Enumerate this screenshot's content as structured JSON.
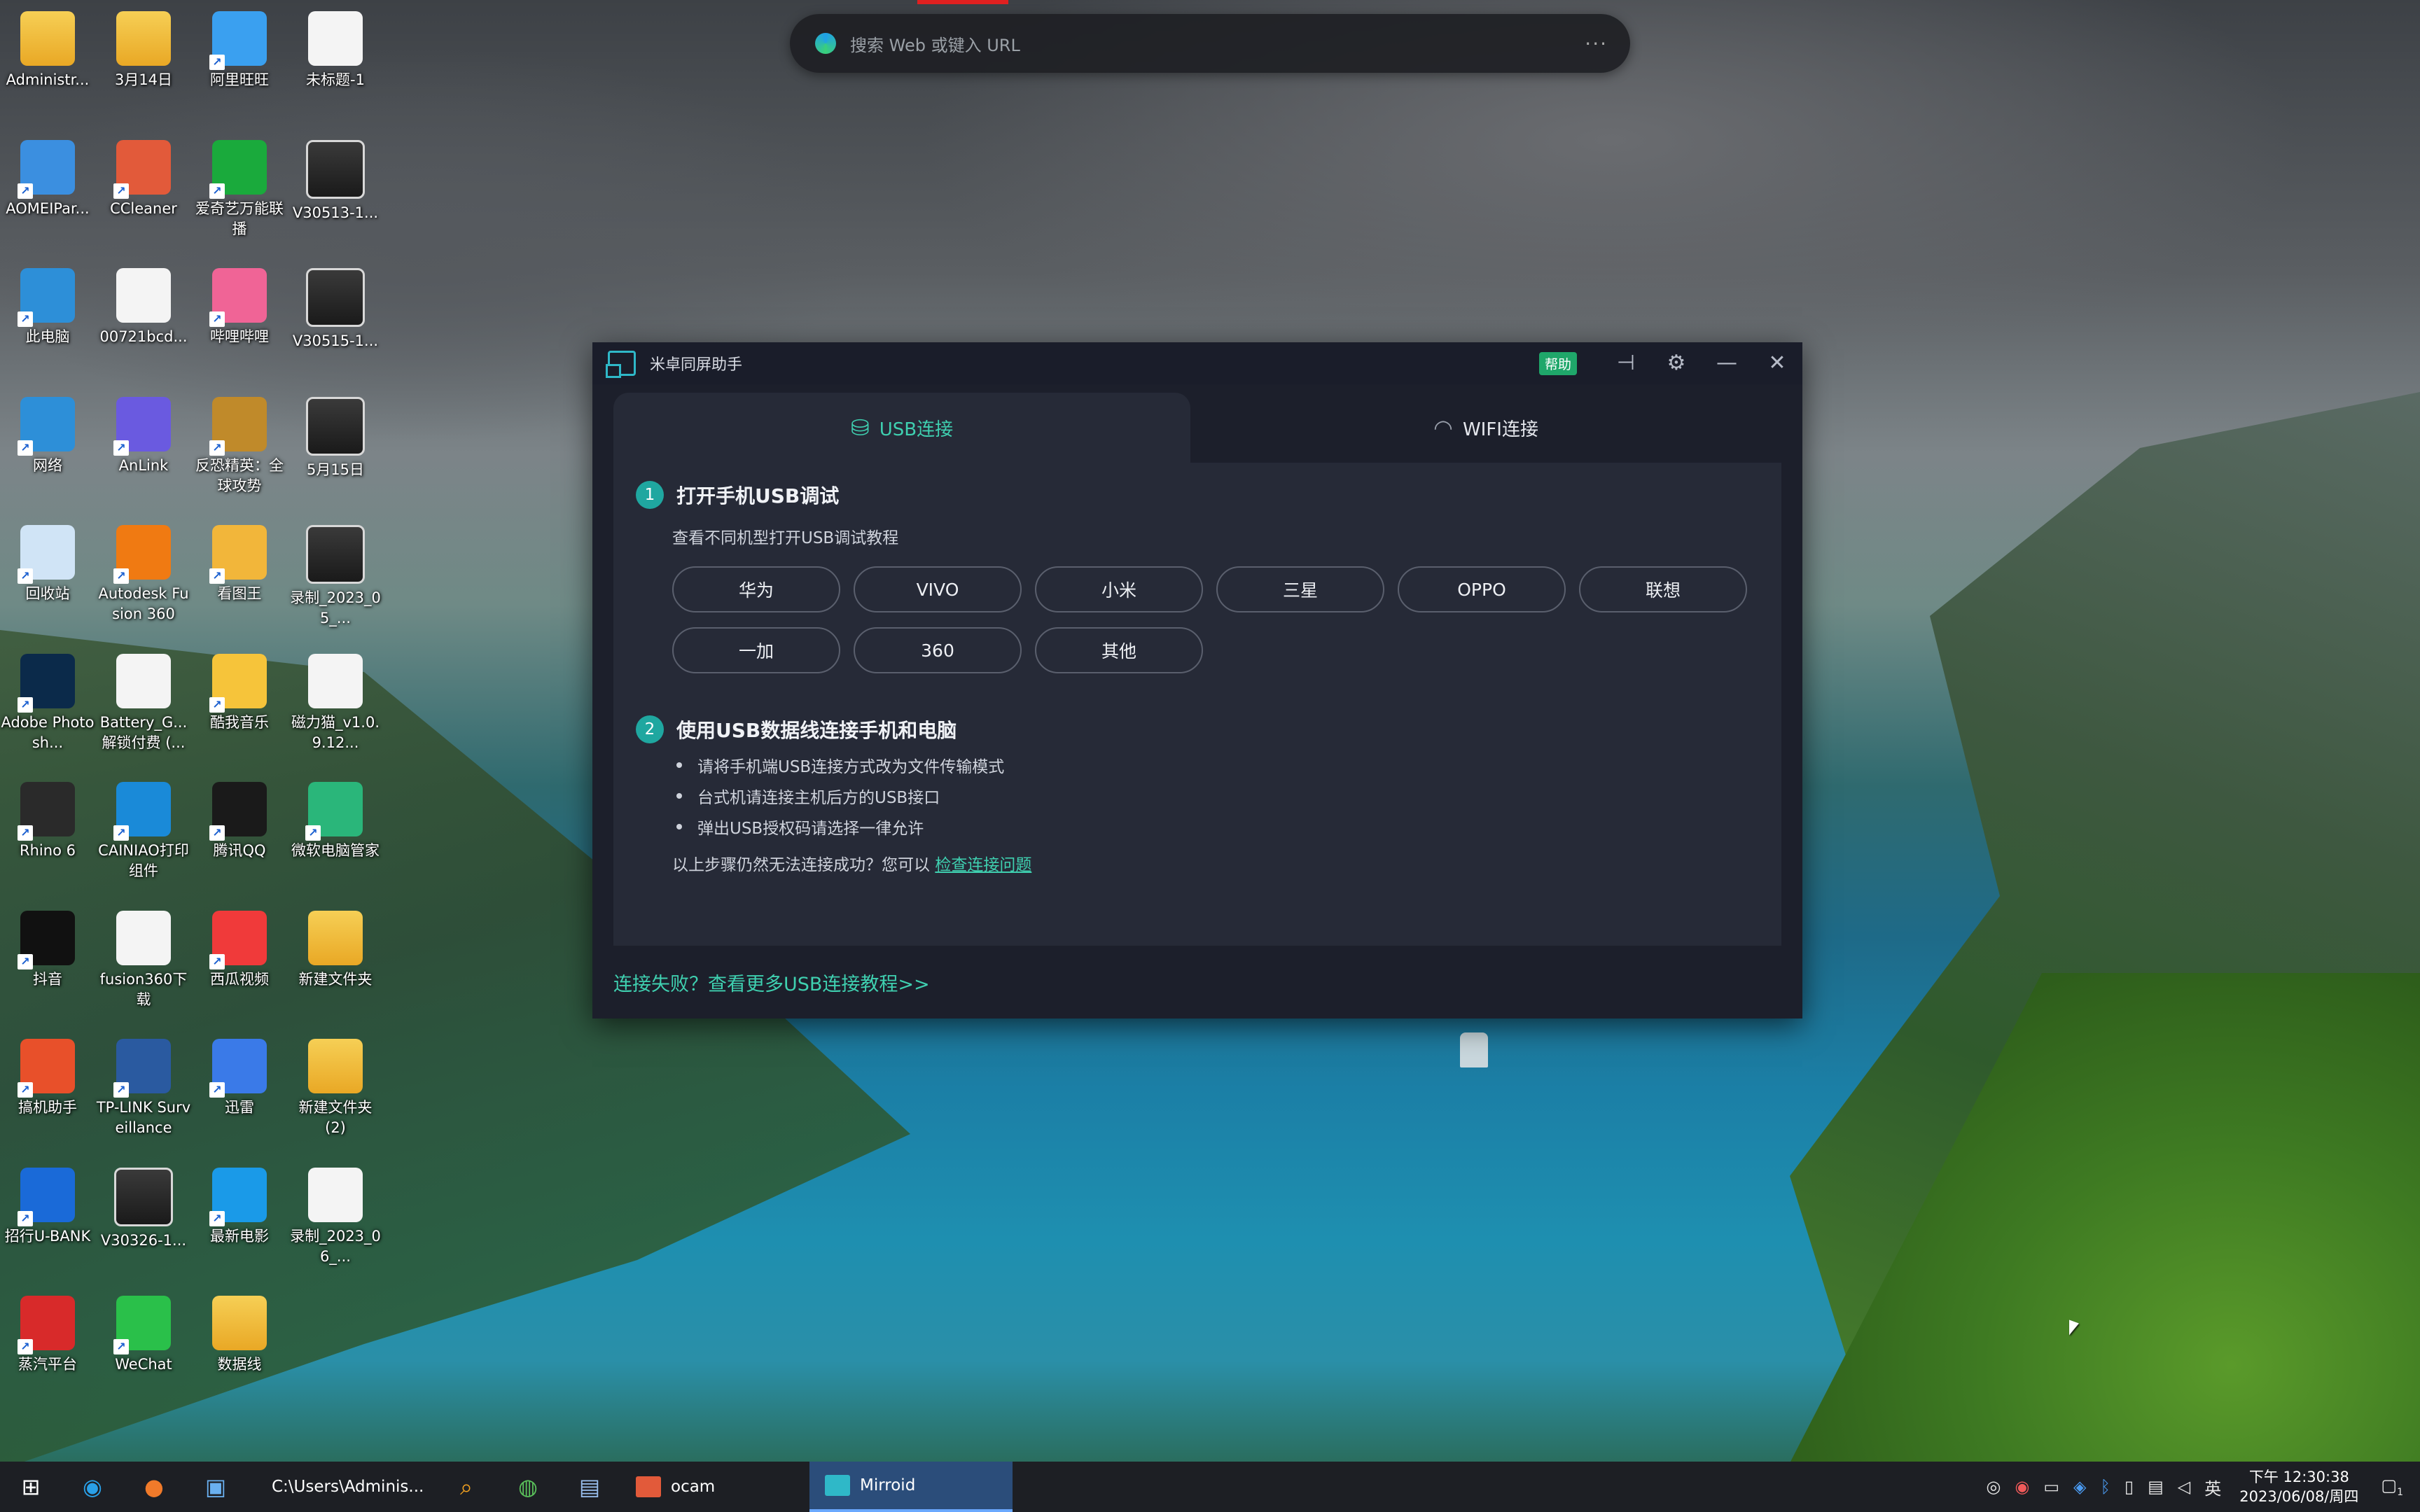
{
  "browser": {
    "placeholder": "搜索 Web 或键入 URL",
    "more": "···"
  },
  "desktop_icons": [
    {
      "label": "Administr...",
      "kind": "folder",
      "color": "#f2c14e"
    },
    {
      "label": "3月14日",
      "kind": "folder",
      "color": "#f2c14e"
    },
    {
      "label": "阿里旺旺",
      "kind": "app",
      "color": "#3aa0f0"
    },
    {
      "label": "未标题-1",
      "kind": "doc",
      "color": "#f4f4f4"
    },
    {
      "label": "AOMEIPar...",
      "kind": "app",
      "color": "#3b8fe0"
    },
    {
      "label": "CCleaner",
      "kind": "app",
      "color": "#e25a3a"
    },
    {
      "label": "爱奇艺万能联播",
      "kind": "app",
      "color": "#1aaa3c"
    },
    {
      "label": "V30513-1...",
      "kind": "video",
      "color": "#2a2a2a"
    },
    {
      "label": "此电脑",
      "kind": "app",
      "color": "#2d8fd8"
    },
    {
      "label": "00721bcd...",
      "kind": "doc",
      "color": "#e9f0fb"
    },
    {
      "label": "哔哩哔哩",
      "kind": "app",
      "color": "#f06496"
    },
    {
      "label": "V30515-1...",
      "kind": "video",
      "color": "#2a2a2a"
    },
    {
      "label": "网络",
      "kind": "app",
      "color": "#2d8fd8"
    },
    {
      "label": "AnLink",
      "kind": "app",
      "color": "#6a5ae0"
    },
    {
      "label": "反恐精英：全球攻势",
      "kind": "app",
      "color": "#c08a2a"
    },
    {
      "label": "5月15日",
      "kind": "video",
      "color": "#2a2a2a"
    },
    {
      "label": "回收站",
      "kind": "app",
      "color": "#d0e4f6"
    },
    {
      "label": "Autodesk Fusion 360",
      "kind": "app",
      "color": "#f07a12"
    },
    {
      "label": "看图王",
      "kind": "app",
      "color": "#f2b63a"
    },
    {
      "label": "录制_2023_05_...",
      "kind": "video",
      "color": "#2a2a2a"
    },
    {
      "label": "Adobe Photosh...",
      "kind": "app",
      "color": "#0b2a4a"
    },
    {
      "label": "Battery_G... 解锁付费 (...",
      "kind": "doc",
      "color": "#f4f4f4"
    },
    {
      "label": "酷我音乐",
      "kind": "app",
      "color": "#f6c43a"
    },
    {
      "label": "磁力猫_v1.0.9.12...",
      "kind": "doc",
      "color": "#f4f4f4"
    },
    {
      "label": "Rhino 6",
      "kind": "app",
      "color": "#2a2a2a"
    },
    {
      "label": "CAINIAO打印组件",
      "kind": "app",
      "color": "#1a8ad8"
    },
    {
      "label": "腾讯QQ",
      "kind": "app",
      "color": "#1a1a1a"
    },
    {
      "label": "微软电脑管家",
      "kind": "app",
      "color": "#2ab67a"
    },
    {
      "label": "抖音",
      "kind": "app",
      "color": "#111111"
    },
    {
      "label": "fusion360下载",
      "kind": "doc",
      "color": "#f4f4f4"
    },
    {
      "label": "西瓜视频",
      "kind": "app",
      "color": "#f03a3a"
    },
    {
      "label": "新建文件夹",
      "kind": "folder",
      "color": "#f2c14e"
    },
    {
      "label": "搞机助手",
      "kind": "app",
      "color": "#e8502a"
    },
    {
      "label": "TP-LINK Surveillance",
      "kind": "app",
      "color": "#2a5aa0"
    },
    {
      "label": "迅雷",
      "kind": "app",
      "color": "#3a7ae8"
    },
    {
      "label": "新建文件夹 (2)",
      "kind": "folder",
      "color": "#f2c14e"
    },
    {
      "label": "招行U-BANK",
      "kind": "app",
      "color": "#1a6ad8"
    },
    {
      "label": "V30326-1...",
      "kind": "video",
      "color": "#2a2a2a"
    },
    {
      "label": "最新电影",
      "kind": "app",
      "color": "#1a9ae8"
    },
    {
      "label": "录制_2023_06_...",
      "kind": "doc",
      "color": "#e9f0fb"
    },
    {
      "label": "蒸汽平台",
      "kind": "app",
      "color": "#d82a2a"
    },
    {
      "label": "WeChat",
      "kind": "app",
      "color": "#2ac04a"
    },
    {
      "label": "数据线",
      "kind": "folder",
      "color": "#f2c14e"
    }
  ],
  "window": {
    "title": "米卓同屏助手",
    "help_badge": "帮助",
    "tabs": {
      "usb": "USB连接",
      "wifi": "WIFI连接"
    },
    "step1": {
      "num": "1",
      "title": "打开手机USB调试",
      "subtitle": "查看不同机型打开USB调试教程",
      "brands": [
        "华为",
        "VIVO",
        "小米",
        "三星",
        "OPPO",
        "联想",
        "一加",
        "360",
        "其他"
      ]
    },
    "step2": {
      "num": "2",
      "title": "使用USB数据线连接手机和电脑",
      "bullets": [
        "请将手机端USB连接方式改为文件传输模式",
        "台式机请连接主机后方的USB接口",
        "弹出USB授权码请选择一律允许"
      ],
      "hint_prefix": "以上步骤仍然无法连接成功？您可以 ",
      "hint_link": "检查连接问题"
    },
    "footer_link": "连接失败？查看更多USB连接教程>>",
    "accent": "#3fd0b0"
  },
  "taskbar": {
    "apps": [
      {
        "label": "C:\\Users\\Adminis...",
        "color": "#f2c14e"
      },
      {
        "label": "ocam",
        "color": "#e25a3a"
      },
      {
        "label": "Mirroid",
        "color": "#2fb8c8"
      }
    ],
    "ime": "英",
    "time": "下午 12:30:38",
    "date": "2023/06/08/周四",
    "notif_count": "1"
  }
}
